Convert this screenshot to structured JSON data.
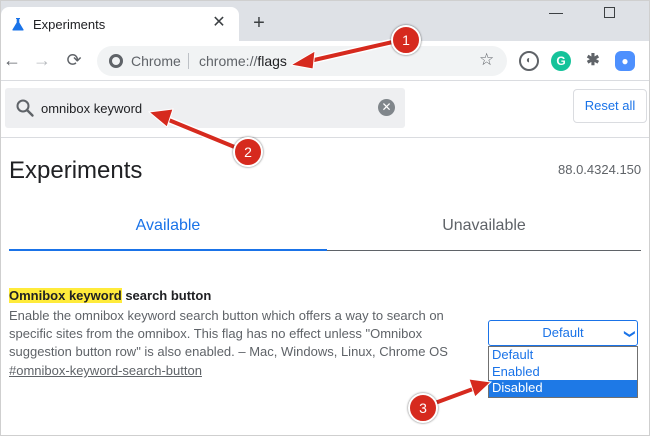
{
  "browser": {
    "tab": {
      "title": "Experiments",
      "close_glyph": "✕"
    },
    "new_tab_glyph": "+",
    "toolbar": {
      "back_glyph": "←",
      "forward_glyph": "→",
      "reload_glyph": "⟳",
      "site_label": "Chrome",
      "url_prefix": "chrome://",
      "url_path": "flags",
      "bookmark_glyph": "☆"
    },
    "extensions": [
      {
        "name": "privacy-extension-icon",
        "glyph": "◐"
      },
      {
        "name": "grammarly-icon",
        "glyph": "G"
      },
      {
        "name": "puzzle-icon",
        "glyph": "✱"
      },
      {
        "name": "profile-extension-icon",
        "glyph": "●"
      }
    ]
  },
  "flags_header": {
    "search_value": "omnibox keyword",
    "clear_glyph": "✕",
    "reset_label": "Reset all"
  },
  "main": {
    "title": "Experiments",
    "version": "88.0.4324.150",
    "tabs": {
      "available": "Available",
      "unavailable": "Unavailable"
    }
  },
  "flag": {
    "title_highlight": "Omnibox keyword",
    "title_rest": " search button",
    "description": "Enable the omnibox keyword search button which offers a way to search on specific sites from the omnibox. This flag has no effect unless \"Omnibox suggestion button row\" is also enabled. – Mac, Windows, Linux, Chrome OS",
    "link": "#omnibox-keyword-search-button",
    "select_value": "Default",
    "select_chevron": "❯",
    "options": [
      "Default",
      "Enabled",
      "Disabled"
    ],
    "selected_option_index": 2
  },
  "annotations": {
    "callout_1": "1",
    "callout_2": "2",
    "callout_3": "3",
    "color": "#d62a1e"
  }
}
